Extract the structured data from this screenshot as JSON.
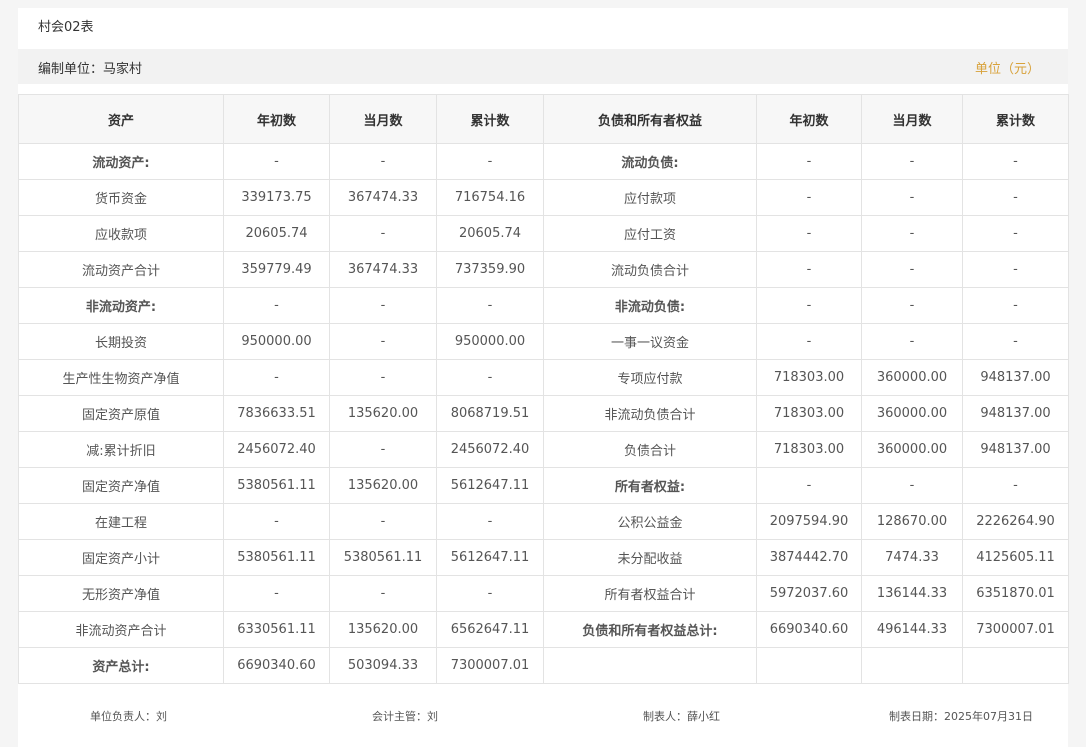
{
  "form_code": "村会02表",
  "unit": {
    "label": "编制单位：马家村",
    "currency": "单位（元）"
  },
  "columns": {
    "asset": "资产",
    "begin": "年初数",
    "month": "当月数",
    "cumulative": "累计数",
    "liability": "负债和所有者权益",
    "begin2": "年初数",
    "month2": "当月数",
    "cumulative2": "累计数"
  },
  "rows": [
    {
      "a": "流动资产:",
      "ab": "-",
      "am": "-",
      "ac": "-",
      "l": "流动负债:",
      "lb": "-",
      "lm": "-",
      "lc": "-"
    },
    {
      "a": "货币资金",
      "ab": "339173.75",
      "am": "367474.33",
      "ac": "716754.16",
      "l": "应付款项",
      "lb": "-",
      "lm": "-",
      "lc": "-"
    },
    {
      "a": "应收款项",
      "ab": "20605.74",
      "am": "-",
      "ac": "20605.74",
      "l": "应付工资",
      "lb": "-",
      "lm": "-",
      "lc": "-"
    },
    {
      "a": "流动资产合计",
      "ab": "359779.49",
      "am": "367474.33",
      "ac": "737359.90",
      "l": "流动负债合计",
      "lb": "-",
      "lm": "-",
      "lc": "-"
    },
    {
      "a": "非流动资产:",
      "ab": "-",
      "am": "-",
      "ac": "-",
      "l": "非流动负债:",
      "lb": "-",
      "lm": "-",
      "lc": "-"
    },
    {
      "a": "长期投资",
      "ab": "950000.00",
      "am": "-",
      "ac": "950000.00",
      "l": "一事一议资金",
      "lb": "-",
      "lm": "-",
      "lc": "-"
    },
    {
      "a": "生产性生物资产净值",
      "ab": "-",
      "am": "-",
      "ac": "-",
      "l": "专项应付款",
      "lb": "718303.00",
      "lm": "360000.00",
      "lc": "948137.00"
    },
    {
      "a": "固定资产原值",
      "ab": "7836633.51",
      "am": "135620.00",
      "ac": "8068719.51",
      "l": "非流动负债合计",
      "lb": "718303.00",
      "lm": "360000.00",
      "lc": "948137.00"
    },
    {
      "a": "减:累计折旧",
      "ab": "2456072.40",
      "am": "-",
      "ac": "2456072.40",
      "l": "负债合计",
      "lb": "718303.00",
      "lm": "360000.00",
      "lc": "948137.00"
    },
    {
      "a": "固定资产净值",
      "ab": "5380561.11",
      "am": "135620.00",
      "ac": "5612647.11",
      "l": "所有者权益:",
      "lb": "-",
      "lm": "-",
      "lc": "-"
    },
    {
      "a": "在建工程",
      "ab": "-",
      "am": "-",
      "ac": "-",
      "l": "公积公益金",
      "lb": "2097594.90",
      "lm": "128670.00",
      "lc": "2226264.90"
    },
    {
      "a": "固定资产小计",
      "ab": "5380561.11",
      "am": "5380561.11",
      "ac": "5612647.11",
      "l": "未分配收益",
      "lb": "3874442.70",
      "lm": "7474.33",
      "lc": "4125605.11"
    },
    {
      "a": "无形资产净值",
      "ab": "-",
      "am": "-",
      "ac": "-",
      "l": "所有者权益合计",
      "lb": "5972037.60",
      "lm": "136144.33",
      "lc": "6351870.01"
    },
    {
      "a": "非流动资产合计",
      "ab": "6330561.11",
      "am": "135620.00",
      "ac": "6562647.11",
      "l": "负债和所有者权益总计:",
      "lb": "6690340.60",
      "lm": "496144.33",
      "lc": "7300007.01"
    },
    {
      "a": "资产总计:",
      "ab": "6690340.60",
      "am": "503094.33",
      "ac": "7300007.01",
      "l": "",
      "lb": "",
      "lm": "",
      "lc": ""
    }
  ],
  "footer": {
    "head": "单位负责人：刘",
    "accountant": "会计主管：刘",
    "preparer": "制表人：薛小红",
    "date": "制表日期：2025年07月31日"
  }
}
